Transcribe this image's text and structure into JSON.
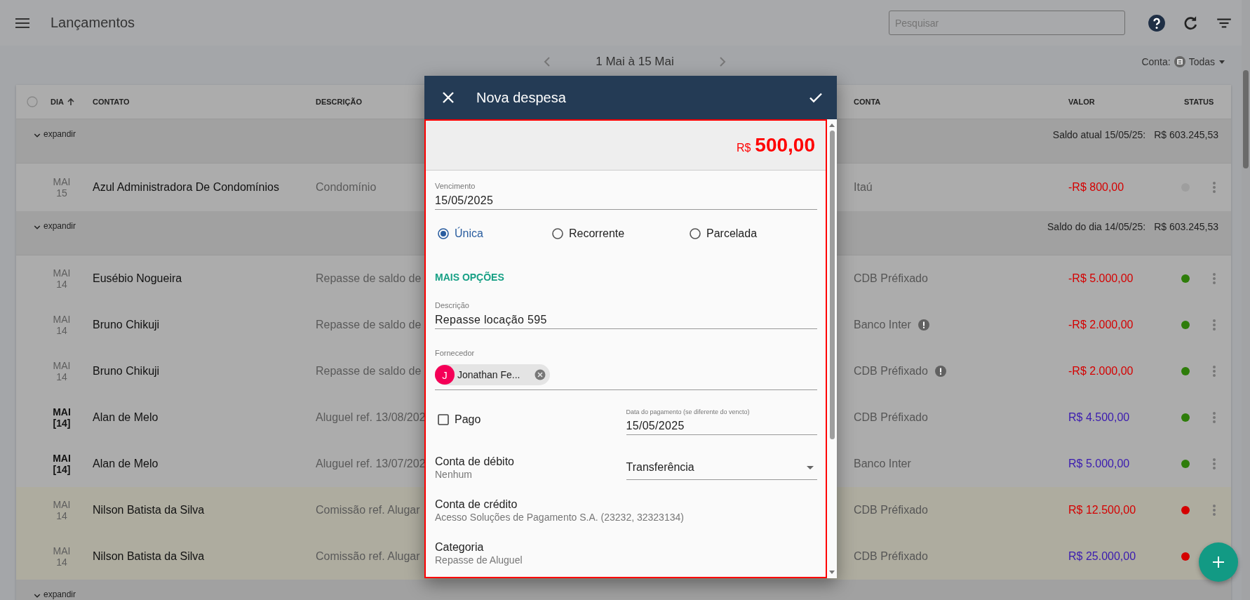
{
  "topbar": {
    "title": "Lançamentos",
    "search": {
      "placeholder": "Pesquisar"
    }
  },
  "period": {
    "label": "1 Mai à 15 Mai"
  },
  "account_filter": {
    "label": "Conta:",
    "value": "Todas"
  },
  "table": {
    "select_all": {
      "checked": false
    },
    "columns": [
      "DIA",
      "CONTATO",
      "DESCRIÇÃO",
      "CONTA",
      "VALOR",
      "STATUS"
    ],
    "groups": [
      {
        "toggle": "expandir",
        "balance_label": "Saldo atual 15/05/25:",
        "balance": "R$ 603.245,53",
        "rows": [
          {
            "month": "MAI",
            "day": "15",
            "bold_date": false,
            "highlighted": false,
            "contact": "Azul Administradora De Condomínios",
            "description": "Condomínio",
            "account": "Itaú",
            "warning": false,
            "amount": {
              "value": "-R$ 800,00",
              "color": "#d50000"
            },
            "status": {
              "color": "#9e9e9e"
            }
          }
        ]
      },
      {
        "toggle": "expandir",
        "balance_label": "Saldo do dia 14/05/25:",
        "balance": "R$ 603.245,53",
        "rows": [
          {
            "month": "MAI",
            "day": "14",
            "bold_date": false,
            "highlighted": false,
            "contact": "Eusébio Nogueira",
            "description": "Repasse de saldo de",
            "account": "CDB Préfixado",
            "warning": false,
            "amount": {
              "value": "-R$ 5.000,00",
              "color": "#d50000"
            },
            "status": {
              "color": "#2e7d0a"
            }
          },
          {
            "month": "MAI",
            "day": "14",
            "bold_date": false,
            "highlighted": false,
            "contact": "Bruno Chikuji",
            "description": "Repasse de saldo de",
            "account": "Banco Inter",
            "warning": true,
            "amount": {
              "value": "-R$ 2.000,00",
              "color": "#d50000"
            },
            "status": {
              "color": "#2e7d0a"
            }
          },
          {
            "month": "MAI",
            "day": "14",
            "bold_date": false,
            "highlighted": false,
            "contact": "Bruno Chikuji",
            "description": "Repasse de saldo de",
            "account": "CDB Préfixado",
            "warning": true,
            "amount": {
              "value": "-R$ 2.000,00",
              "color": "#d50000"
            },
            "status": {
              "color": "#2e7d0a"
            }
          },
          {
            "month": "MAI",
            "day": "[14]",
            "bold_date": true,
            "highlighted": false,
            "contact": "Alan de Melo",
            "description": "Aluguel ref. 13/08/202",
            "account": "CDB Préfixado",
            "warning": false,
            "amount": {
              "value": "R$ 4.500,00",
              "color": "#3a1ab0"
            },
            "status": {
              "color": "#2e7d0a"
            }
          },
          {
            "month": "MAI",
            "day": "[14]",
            "bold_date": true,
            "highlighted": false,
            "contact": "Alan de Melo",
            "description": "Aluguel ref. 13/07/202",
            "account": "Banco Inter",
            "warning": false,
            "amount": {
              "value": "R$ 5.000,00",
              "color": "#3a1ab0"
            },
            "status": {
              "color": "#2e7d0a"
            }
          },
          {
            "month": "MAI",
            "day": "14",
            "bold_date": false,
            "highlighted": true,
            "contact": "Nilson Batista da Silva",
            "description": "Comissão ref. Alugar",
            "account": "CDB Préfixado",
            "warning": false,
            "amount": {
              "value": "R$ 12.500,00",
              "color": "#d50000"
            },
            "status": {
              "color": "#d50000"
            }
          },
          {
            "month": "MAI",
            "day": "14",
            "bold_date": false,
            "highlighted": true,
            "contact": "Nilson Batista da Silva",
            "description": "Comissão ref. Alugar",
            "account": "CDB Préfixado",
            "warning": false,
            "amount": {
              "value": "R$ 25.000,00",
              "color": "#3a1ab0"
            },
            "status": {
              "color": "#d50000"
            },
            "covered": true
          }
        ]
      },
      {
        "toggle": "expandir"
      }
    ]
  },
  "modal": {
    "title": "Nova despesa",
    "amount": {
      "currency": "R$",
      "value": "500,00"
    },
    "due": {
      "label": "Vencimento",
      "value": "15/05/2025"
    },
    "recurrence": [
      {
        "label": "Única",
        "selected": true
      },
      {
        "label": "Recorrente",
        "selected": false
      },
      {
        "label": "Parcelada",
        "selected": false
      }
    ],
    "more_options": "MAIS OPÇÕES",
    "description": {
      "label": "Descrição",
      "value": "Repasse locação 595"
    },
    "supplier": {
      "label": "Fornecedor",
      "chip": {
        "initial": "J",
        "name": "Jonathan Fe..."
      }
    },
    "paid": {
      "label": "Pago",
      "checked": false
    },
    "payment_date": {
      "label": "Data do pagamento (se diferente do vencto)",
      "value": "15/05/2025"
    },
    "debit": {
      "label": "Conta de débito",
      "value": "Nenhum"
    },
    "method": {
      "value": "Transferência"
    },
    "credit": {
      "label": "Conta de crédito",
      "value": "Acesso Soluções de Pagamento S.A. (23232, 32323134)"
    },
    "category": {
      "label": "Categoria",
      "value": "Repasse de Aluguel"
    }
  }
}
